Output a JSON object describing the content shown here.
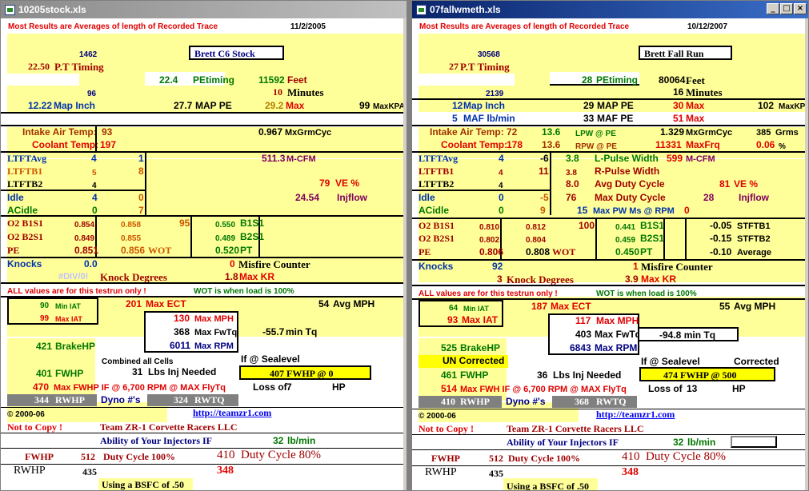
{
  "win1": {
    "title": "10205stock.xls",
    "header": "Most Results are Averages of length of Recorded Trace",
    "date": "11/2/2005",
    "n1462": "1462",
    "car_name": "Brett C6 Stock",
    "pt_value": "22.50",
    "pt_label": "P.T Timing",
    "pe_value": "22.4",
    "pe_label": "PEtiming",
    "feet_value": "11592",
    "feet_label": "Feet",
    "n96": "96",
    "min_value": "10",
    "min_label": "Minutes",
    "map_inch_value": "12.22",
    "map_inch_label": "Map Inch",
    "map_pe_value": "27.7",
    "map_pe_label": "MAP PE",
    "max_value": "29.2",
    "max_label": "Max",
    "maxkpa_value": "99",
    "maxkpa_label": "MaxKPA",
    "iat_label": "Intake Air Temp:",
    "iat_value": "93",
    "mxgrm_value": "0.967",
    "mxgrm_label": "MxGrmCyc",
    "coolant_label": "Coolant Temp:",
    "coolant_value": "197",
    "ltftavg_label": "LTFTAvg",
    "ltftavg_a": "4",
    "ltftavg_b": "1",
    "mcfm_value": "511.3",
    "mcfm_label": "M-CFM",
    "ltftb1_label": "LTFTB1",
    "ltftb1_a": "5",
    "ltftb1_b": "8",
    "ltftb2_label": "LTFTB2",
    "ltftb2_a": "4",
    "ve_value": "79",
    "ve_label": "VE %",
    "idle_label": "Idle",
    "idle_a": "4",
    "idle_b": "0",
    "injflow_value": "24.54",
    "injflow_label": "Injflow",
    "acidle_label": "ACidle",
    "acidle_a": "0",
    "acidle_b": "7",
    "o2b1s1_label": "O2 B1S1",
    "o2b1s1_a": "0.854",
    "o2b1s1_b": "0.858",
    "o2b1s1_c": "95",
    "o2b1s1_d": "0.550",
    "o2b1s1_e": "B1S1",
    "o2b2s1_label": "O2 B2S1",
    "o2b2s1_a": "0.849",
    "o2b2s1_b": "0.855",
    "o2b2s1_d": "0.489",
    "o2b2s1_e": "B2S1",
    "pe_row_label": "PE",
    "pe_row_a": "0.851",
    "pe_row_b": "0.856",
    "wot_label": "WOT",
    "pe_row_d": "0.520",
    "pt_label2": "PT",
    "knocks_label": "Knocks",
    "knocks_value": "0.0",
    "misfire_value": "0",
    "misfire_label": "Misfire Counter",
    "div0": "#DIV/0!",
    "knock_deg_label": "Knock  Degrees",
    "maxkr_value": "1.8",
    "maxkr_label": "Max KR",
    "all_values_note": "ALL values are for this testrun only !",
    "wot_note": "WOT is when load is 100%",
    "miniat_value": "90",
    "miniat_label": "Min IAT",
    "maxect_value": "201",
    "maxect_label": "Max ECT",
    "avgmph_value": "54",
    "avgmph_label": "Avg MPH",
    "maxiat_value": "99",
    "maxiat_label": "Max IAT",
    "maxmph_value": "130",
    "maxmph_label": "Max MPH",
    "maxfwtq_value": "368",
    "maxfwtq_label": "Max FwTq",
    "mintq_value": "-55.7",
    "mintq_label": "min Tq",
    "maxrpm_value": "6011",
    "maxrpm_label": "Max RPM",
    "brakehp_value": "421",
    "brakehp_label": "BrakeHP",
    "combined_label": "Combined all Cells",
    "sealevel_label": "If @ Sealevel",
    "fwhp_value": "401",
    "fwhp_label": "FWHP",
    "lbs_inj_value": "31",
    "lbs_inj_label": "Lbs Inj Needed",
    "sea_fwhp_value": "407",
    "sea_fwhp_label": "FWHP  @",
    "sea_fwhp_at": "0",
    "maxfwhp_value": "470",
    "maxfwhp_label": "Max FWHP IF @ 6,700 RPM @ MAX FlyTq",
    "loss_label": "Loss of",
    "loss_value": "7",
    "hp_label": "HP",
    "rwhp_value": "344",
    "rwhp_label": "RWHP",
    "dyno_label": "Dyno #'s",
    "rwtq_value": "324",
    "rwtq_label": "RWTQ",
    "copyright": "© 2000-06",
    "url": "http://teamzr1.com",
    "notcopy": "Not to Copy !",
    "team": "Team ZR-1 Corvette Racers LLC",
    "ability_label": "Ability of Your Injectors IF",
    "lbmin_value": "32",
    "lbmin_label": "lb/min",
    "fwhp2_label": "FWHP",
    "duty100_value": "512",
    "duty100_label": "Duty Cycle 100%",
    "duty80_value": "410",
    "duty80_label": "Duty Cycle 80%",
    "rwhp2_label": "RWHP",
    "rwhp2_value": "435",
    "rwhp2_value80": "348",
    "bsfc_label": "Using a BSFC of .50"
  },
  "win2": {
    "title": "07fallwmeth.xls",
    "header": "Most Results are Averages of length of Recorded Trace",
    "date": "10/12/2007",
    "n30568": "30568",
    "car_name": "Brett Fall Run",
    "pt_value": "27",
    "pt_label": "P.T Timing",
    "pe_value": "28",
    "pe_label": "PEtiming",
    "feet_value": "80064",
    "feet_label": "Feet",
    "n2139": "2139",
    "min_value": "16",
    "min_label": "Minutes",
    "map_inch_value": "12",
    "map_inch_label": "Map Inch",
    "map_pe_value": "29",
    "map_pe_label": "MAP PE",
    "max_value": "30",
    "max_label": "Max",
    "maxkpa_value": "102",
    "maxkpa_label": "MaxKPA",
    "maf_value": "5",
    "maf_label": "MAF lb/min",
    "maf_pe_value": "33",
    "maf_pe_label": "MAF PE",
    "maf_max_value": "51",
    "maf_max_label": "Max",
    "iat_label": "Intake Air Temp:",
    "iat_value": "72",
    "lpw_value": "13.6",
    "lpw_label": "LPW @ PE",
    "mxgrm_value": "1.329",
    "mxgrm_label": "MxGrmCyc",
    "grms_value": "385",
    "grms_label": "Grms",
    "coolant_label": "Coolant Temp:",
    "coolant_value": "178",
    "rpw_value": "13.6",
    "rpw_label": "RPW @ PE",
    "maxfrq_value": "11331",
    "maxfrq_label": "MaxFrq",
    "pct_value": "0.06",
    "pct_label": "%",
    "ltftavg_label": "LTFTAvg",
    "ltftavg_a": "4",
    "ltftavg_b": "-6",
    "lpulse_value": "3.8",
    "lpulse_label": "L-Pulse Width",
    "mcfm_value": "599",
    "mcfm_label": "M-CFM",
    "ltftb1_label": "LTFTB1",
    "ltftb1_a": "4",
    "ltftb1_b": "11",
    "rpulse_value": "3.8",
    "rpulse_label": "R-Pulse Width",
    "ltftb2_label": "LTFTB2",
    "ltftb2_a": "4",
    "avgduty_value": "8.0",
    "avgduty_label": "Avg Duty Cycle",
    "ve_value": "81",
    "ve_label": "VE %",
    "idle_label": "Idle",
    "idle_a": "0",
    "idle_b": "-5",
    "maxduty_value": "76",
    "maxduty_label": "Max Duty Cycle",
    "injflow_value": "28",
    "injflow_label": "Injflow",
    "acidle_label": "ACidle",
    "acidle_a": "0",
    "acidle_b": "9",
    "maxpw_value": "15",
    "maxpw_label": "Max PW Ms @ RPM",
    "maxpw_rpm": "0",
    "o2b1s1_label": "O2 B1S1",
    "o2b1s1_a": "0.810",
    "o2b1s1_b": "0.812",
    "o2b1s1_c": "100",
    "o2b1s1_d": "0.441",
    "o2b1s1_e": "B1S1",
    "stftb1_value": "-0.05",
    "stftb1_label": "STFTB1",
    "o2b2s1_label": "O2 B2S1",
    "o2b2s1_a": "0.802",
    "o2b2s1_b": "0.804",
    "o2b2s1_d": "0.459",
    "o2b2s1_e": "B2S1",
    "stftb2_value": "-0.15",
    "stftb2_label": "STFTB2",
    "pe_row_label": "PE",
    "pe_row_a": "0.806",
    "pe_row_b": "0.808",
    "wot_label": "WOT",
    "pe_row_d": "0.450",
    "pt_label2": "PT",
    "avg_value": "-0.10",
    "avg_label": "Average",
    "knocks_label": "Knocks",
    "knocks_value": "92",
    "misfire_value": "1",
    "misfire_label": "Misfire Counter",
    "knock_deg_value": "3",
    "knock_deg_label": "Knock  Degrees",
    "maxkr_value": "3.9",
    "maxkr_label": "Max KR",
    "all_values_note": "ALL values are for this testrun only !",
    "wot_note": "WOT is when load is 100%",
    "miniat_value": "64",
    "miniat_label": "Min IAT",
    "maxect_value": "187",
    "maxect_label": "Max ECT",
    "avgmph_value": "55",
    "avgmph_label": "Avg MPH",
    "maxiat_value": "93",
    "maxiat_label": "Max IAT",
    "maxmph_value": "117",
    "maxmph_label": "Max MPH",
    "maxfwtq_value": "403",
    "maxfwtq_label": "Max FwTq",
    "mintq_value": "-94.8",
    "mintq_label": "min Tq",
    "maxrpm_value": "6843",
    "maxrpm_label": "Max RPM",
    "brakehp_value": "525",
    "brakehp_label": "BrakeHP",
    "uncorrected_label": "UN Corrected",
    "sealevel_label": "If @ Sealevel",
    "corrected_label": "Corrected",
    "fwhp_value": "461",
    "fwhp_label": "FWHP",
    "lbs_inj_value": "36",
    "lbs_inj_label": "Lbs Inj Needed",
    "sea_fwhp_value": "474",
    "sea_fwhp_label": "FWHP  @",
    "sea_fwhp_at": "500",
    "maxfwhp_value": "514",
    "maxfwhp_label": "Max FWH IF @ 6,700 RPM @ MAX FlyTq",
    "loss_label": "Loss of",
    "loss_value": "13",
    "hp_label": "HP",
    "rwhp_value": "410",
    "rwhp_label": "RWHP",
    "dyno_label": "Dyno #'s",
    "rwtq_value": "368",
    "rwtq_label": "RWTQ",
    "copyright": "© 2000-06",
    "url": "http://teamzr1.com",
    "notcopy": "Not to Copy !",
    "team": "Team ZR-1 Corvette Racers LLC",
    "ability_label": "Ability of Your Injectors IF",
    "lbmin_value": "32",
    "lbmin_label": "lb/min",
    "fwhp2_label": "FWHP",
    "duty100_value": "512",
    "duty100_label": "Duty Cycle 100%",
    "duty80_value": "410",
    "duty80_label": "Duty Cycle 80%",
    "rwhp2_label": "RWHP",
    "rwhp2_value": "435",
    "rwhp2_value80": "348",
    "bsfc_label": "Using a BSFC of .50"
  },
  "controls": {
    "minimize": "_",
    "maximize": "□",
    "close": "×"
  }
}
